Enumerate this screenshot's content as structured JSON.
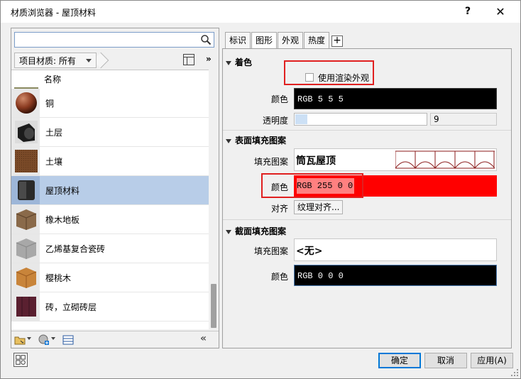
{
  "window": {
    "title": "材质浏览器 - 屋顶材料",
    "help_label": "?",
    "close_label": "✕"
  },
  "left": {
    "search_placeholder": "",
    "scope_label": "项目材质: 所有",
    "more_label": "»",
    "list_header": "名称",
    "materials": [
      {
        "label": "铜",
        "thumb": "copper-sphere"
      },
      {
        "label": "土层",
        "thumb": "soil-layer"
      },
      {
        "label": "土壤",
        "thumb": "soil"
      },
      {
        "label": "屋顶材料",
        "thumb": "roof-material",
        "selected": true
      },
      {
        "label": "橡木地板",
        "thumb": "oak-floor"
      },
      {
        "label": "乙烯基复合瓷砖",
        "thumb": "vinyl-tile"
      },
      {
        "label": "樱桃木",
        "thumb": "cherry-wood"
      },
      {
        "label": "砖，立砌砖层",
        "thumb": "brick-soldier"
      }
    ],
    "collapse_label": "«"
  },
  "tabs": [
    {
      "label": "标识",
      "active": false
    },
    {
      "label": "图形",
      "active": true
    },
    {
      "label": "外观",
      "active": false
    },
    {
      "label": "热度",
      "active": false
    }
  ],
  "tab_add_label": "+",
  "graphics": {
    "shading": {
      "header": "着色",
      "use_render_label": "使用渲染外观",
      "use_render_checked": false,
      "color_label": "颜色",
      "color_value": "RGB 5 5 5",
      "color_hex": "#000000",
      "transparency_label": "透明度",
      "transparency_value": "9",
      "transparency_fraction": 0.09
    },
    "surface": {
      "header": "表面填充图案",
      "pattern_label": "填充图案",
      "pattern_value": "筒瓦屋顶",
      "color_label": "颜色",
      "color_value": "RGB 255 0 0",
      "color_hex": "#ff0000",
      "align_label": "对齐",
      "align_value": "纹理对齐..."
    },
    "cut": {
      "header": "截面填充图案",
      "pattern_label": "填充图案",
      "pattern_value": "<无>",
      "color_label": "颜色",
      "color_value": "RGB 0 0 0",
      "color_hex": "#000000"
    }
  },
  "buttons": {
    "ok": "确定",
    "cancel": "取消",
    "apply": "应用(A)"
  }
}
